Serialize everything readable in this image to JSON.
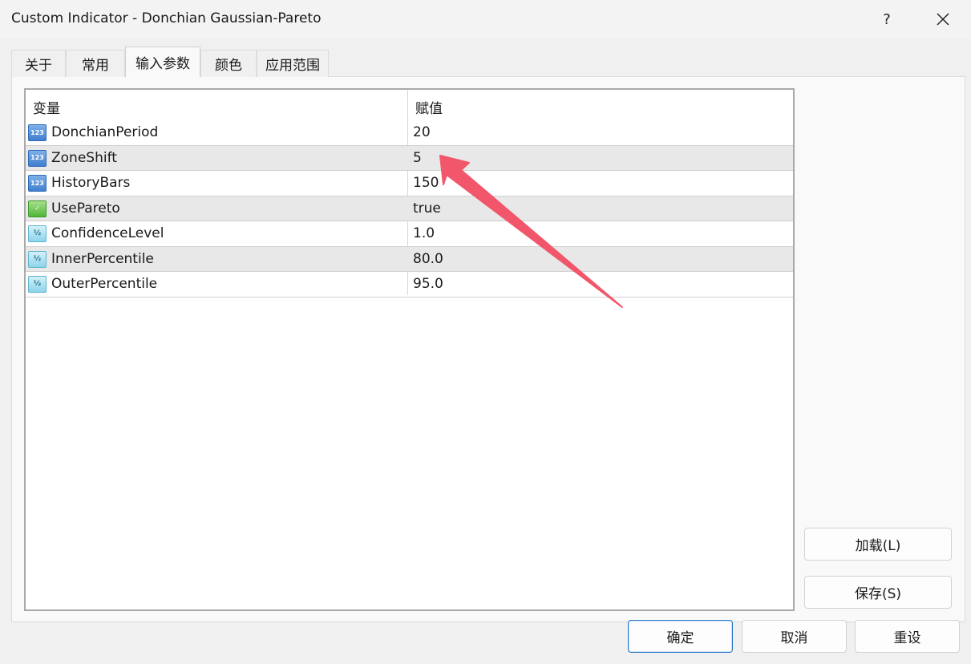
{
  "window": {
    "title": "Custom Indicator - Donchian Gaussian-Pareto",
    "help_label": "?",
    "close_label": "✕"
  },
  "tabs": [
    {
      "label": "关于"
    },
    {
      "label": "常用"
    },
    {
      "label": "输入参数",
      "active": true
    },
    {
      "label": "颜色"
    },
    {
      "label": "应用范围"
    }
  ],
  "grid": {
    "headers": {
      "variable": "变量",
      "value": "赋值"
    },
    "rows": [
      {
        "name": "DonchianPeriod",
        "value": "20",
        "icon": "int-icon",
        "icon_text": "123"
      },
      {
        "name": "ZoneShift",
        "value": "5",
        "icon": "int-icon",
        "icon_text": "123"
      },
      {
        "name": "HistoryBars",
        "value": "150",
        "icon": "int-icon",
        "icon_text": "123"
      },
      {
        "name": "UsePareto",
        "value": "true",
        "icon": "bool-icon",
        "icon_text": "✓"
      },
      {
        "name": "ConfidenceLevel",
        "value": "1.0",
        "icon": "double-icon",
        "icon_text": "½"
      },
      {
        "name": "InnerPercentile",
        "value": "80.0",
        "icon": "double-icon",
        "icon_text": "½"
      },
      {
        "name": "OuterPercentile",
        "value": "95.0",
        "icon": "double-icon",
        "icon_text": "½"
      }
    ]
  },
  "side_buttons": {
    "load": "加载(L)",
    "save": "保存(S)"
  },
  "footer_buttons": {
    "ok": "确定",
    "cancel": "取消",
    "reset": "重设"
  },
  "annotation": {
    "arrow_color": "#f2566b"
  }
}
